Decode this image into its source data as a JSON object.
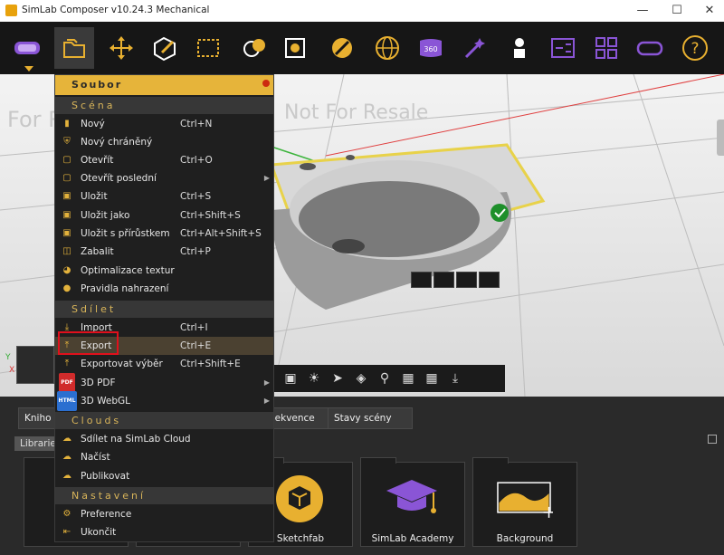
{
  "window": {
    "title": "SimLab Composer v10.24.3 Mechanical",
    "controls": [
      "minimize",
      "maximize",
      "close"
    ]
  },
  "toolbar": {
    "tools": [
      {
        "name": "vr-headset-icon",
        "color": "#8a55d6"
      },
      {
        "name": "folder-icon",
        "color": "#e8b030"
      },
      {
        "name": "move-icon",
        "color": "#e8b030"
      },
      {
        "name": "edit-icon",
        "color": "#e8b030"
      },
      {
        "name": "selection-icon",
        "color": "#e8b030"
      },
      {
        "name": "materials-icon",
        "color": "#e8b030"
      },
      {
        "name": "render-icon",
        "color": "#e8b030"
      },
      {
        "name": "texture-icon",
        "color": "#e8b030"
      },
      {
        "name": "globe-icon",
        "color": "#e8b030"
      },
      {
        "name": "vr-360-icon",
        "color": "#8a55d6"
      },
      {
        "name": "magic-icon",
        "color": "#8a55d6"
      },
      {
        "name": "tutor-icon",
        "color": "#ffffff"
      },
      {
        "name": "animation-icon",
        "color": "#8a55d6"
      },
      {
        "name": "layout-icon",
        "color": "#8a55d6"
      },
      {
        "name": "vr-view-icon",
        "color": "#8a55d6"
      },
      {
        "name": "help-icon",
        "color": "#e8b030"
      }
    ]
  },
  "viewport": {
    "watermark": "Not For Resale",
    "watermark_left": "For R"
  },
  "menu": {
    "header": "Soubor",
    "sections": [
      {
        "title": "Scéna",
        "items": [
          {
            "label": "Nový",
            "shortcut": "Ctrl+N",
            "icon": "new-file-icon",
            "submenu": false
          },
          {
            "label": "Nový chráněný",
            "shortcut": "",
            "icon": "shield-icon",
            "submenu": false
          },
          {
            "label": "Otevřít",
            "shortcut": "Ctrl+O",
            "icon": "open-folder-icon",
            "submenu": false
          },
          {
            "label": "Otevřít poslední",
            "shortcut": "",
            "icon": "recent-folder-icon",
            "submenu": true
          },
          {
            "label": "Uložit",
            "shortcut": "Ctrl+S",
            "icon": "save-icon",
            "submenu": false
          },
          {
            "label": "Uložit jako",
            "shortcut": "Ctrl+Shift+S",
            "icon": "save-as-icon",
            "submenu": false
          },
          {
            "label": "Uložit s přírůstkem",
            "shortcut": "Ctrl+Alt+Shift+S",
            "icon": "save-increment-icon",
            "submenu": false
          },
          {
            "label": "Zabalit",
            "shortcut": "Ctrl+P",
            "icon": "package-icon",
            "submenu": false
          },
          {
            "label": "Optimalizace textur",
            "shortcut": "",
            "icon": "optimize-icon",
            "submenu": false
          },
          {
            "label": "Pravidla nahrazení",
            "shortcut": "",
            "icon": "rules-icon",
            "submenu": false
          }
        ]
      },
      {
        "title": "Sdílet",
        "items": [
          {
            "label": "Import",
            "shortcut": "Ctrl+I",
            "icon": "import-icon",
            "submenu": false
          },
          {
            "label": "Export",
            "shortcut": "Ctrl+E",
            "icon": "export-icon",
            "submenu": false,
            "highlighted": true
          },
          {
            "label": "Exportovat výběr",
            "shortcut": "Ctrl+Shift+E",
            "icon": "export-selection-icon",
            "submenu": false
          },
          {
            "label": "3D PDF",
            "shortcut": "",
            "icon": "pdf-icon",
            "badge": "PDF",
            "submenu": true
          },
          {
            "label": "3D WebGL",
            "shortcut": "",
            "icon": "html-icon",
            "badge": "HTML",
            "submenu": true
          }
        ]
      },
      {
        "title": "Clouds",
        "items": [
          {
            "label": "Sdílet na SimLab Cloud",
            "shortcut": "",
            "icon": "cloud-share-icon",
            "submenu": false
          },
          {
            "label": "Načíst",
            "shortcut": "",
            "icon": "cloud-download-icon",
            "submenu": false
          },
          {
            "label": "Publikovat",
            "shortcut": "",
            "icon": "cloud-upload-icon",
            "submenu": false
          }
        ]
      },
      {
        "title": "Nastavení",
        "items": [
          {
            "label": "Preference",
            "shortcut": "",
            "icon": "gear-icon",
            "submenu": false
          },
          {
            "label": "Ukončit",
            "shortcut": "",
            "icon": "exit-icon",
            "submenu": false
          }
        ]
      }
    ]
  },
  "bottom_panel": {
    "tabs": [
      "Kniho",
      "Sekvence",
      "Stavy scény"
    ],
    "library_select": "Librarie",
    "cards": [
      {
        "caption": ""
      },
      {
        "caption": ""
      },
      {
        "caption": "Sketchfab"
      },
      {
        "caption": "SimLab Academy"
      },
      {
        "caption": "Background"
      }
    ]
  },
  "colors": {
    "accent": "#e6b43a",
    "menu_bg": "#1f1f1f",
    "highlight": "#4b4131",
    "annotation": "#e0101c"
  }
}
